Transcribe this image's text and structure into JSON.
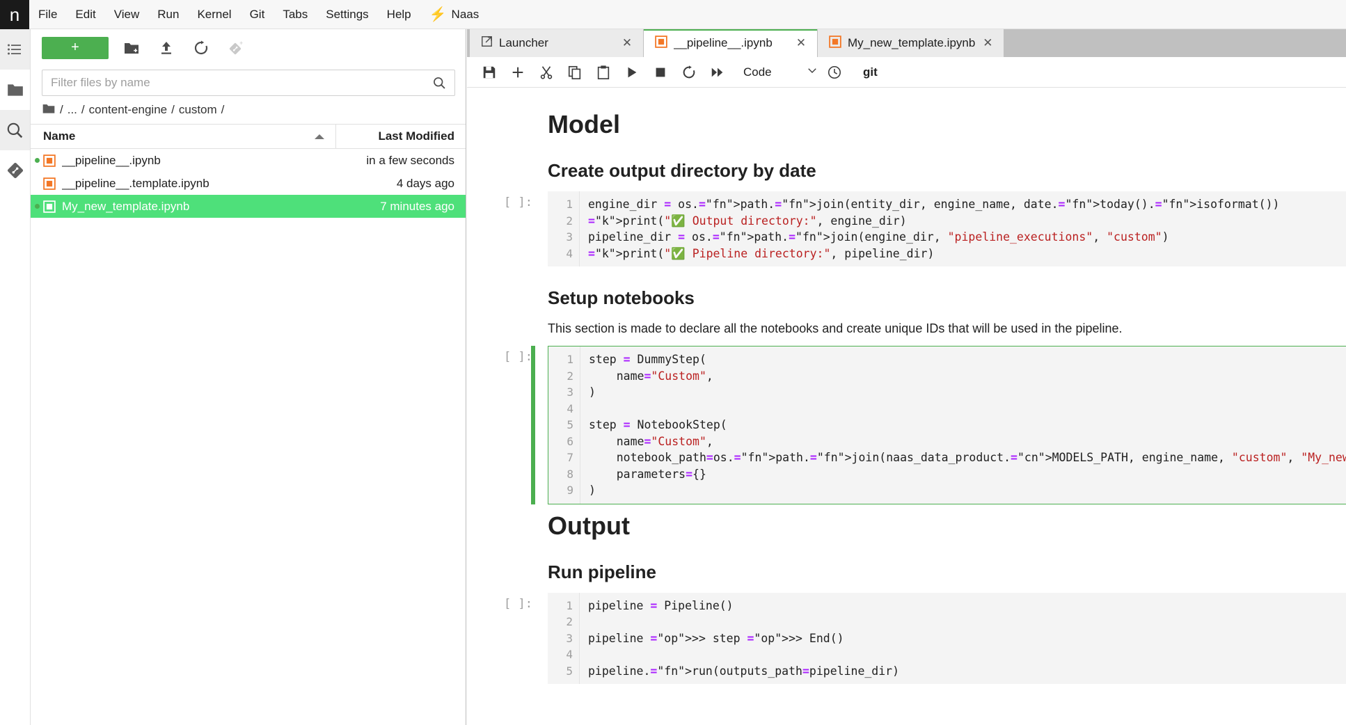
{
  "menubar": {
    "brand": "n",
    "items": [
      "File",
      "Edit",
      "View",
      "Run",
      "Kernel",
      "Git",
      "Tabs",
      "Settings",
      "Help"
    ],
    "naas_label": "Naas"
  },
  "activitybar": {
    "items": [
      {
        "name": "running-terminals-and-kernels",
        "icon": "list-icon"
      },
      {
        "name": "file-browser",
        "icon": "folder-icon"
      },
      {
        "name": "search",
        "icon": "search-icon"
      },
      {
        "name": "git",
        "icon": "git-icon"
      }
    ]
  },
  "filebrowser": {
    "new_launcher_label": "+",
    "toolbar_icons": [
      "new-folder-icon",
      "upload-icon",
      "refresh-icon",
      "new-git-icon"
    ],
    "filter": {
      "placeholder": "Filter files by name",
      "value": ""
    },
    "breadcrumb": [
      "/",
      "...",
      "/",
      "content-engine",
      "/",
      "custom",
      "/"
    ],
    "columns": {
      "name": "Name",
      "modified": "Last Modified"
    },
    "files": [
      {
        "name": "__pipeline__.ipynb",
        "modified": "in a few seconds",
        "running": true,
        "selected": false
      },
      {
        "name": "__pipeline__.template.ipynb",
        "modified": "4 days ago",
        "running": false,
        "selected": false
      },
      {
        "name": "My_new_template.ipynb",
        "modified": "7 minutes ago",
        "running": true,
        "selected": true
      }
    ]
  },
  "tabs": [
    {
      "label": "Launcher",
      "icon": "launcher-icon",
      "active": false,
      "close": "✕"
    },
    {
      "label": "__pipeline__.ipynb",
      "icon": "notebook-icon",
      "active": true,
      "close": "✕"
    },
    {
      "label": "My_new_template.ipynb",
      "icon": "notebook-icon",
      "active": false,
      "close": "✕"
    }
  ],
  "notebook_toolbar": {
    "icons": [
      "save-icon",
      "add-cell-icon",
      "cut-icon",
      "copy-icon",
      "paste-icon",
      "run-icon",
      "stop-icon",
      "restart-icon",
      "restart-run-all-icon"
    ],
    "cell_type": "Code",
    "chevron": "∨",
    "history_icon": "clock-icon",
    "git_label": "git"
  },
  "notebook": {
    "cells": [
      {
        "type": "markdown",
        "style": "h1",
        "text": "Model"
      },
      {
        "type": "markdown",
        "style": "h2",
        "text": "Create output directory by date"
      },
      {
        "type": "code",
        "prompt": "[ ]:",
        "focused": false,
        "lines": [
          "1",
          "2",
          "3",
          "4"
        ],
        "source_plain": [
          "engine_dir = os.path.join(entity_dir, engine_name, date.today().isoformat())",
          "print(\"✅ Output directory:\", engine_dir)",
          "pipeline_dir = os.path.join(engine_dir, \"pipeline_executions\", \"custom\")",
          "print(\"✅ Pipeline directory:\", pipeline_dir)"
        ]
      },
      {
        "type": "markdown",
        "style": "h2",
        "text": "Setup notebooks"
      },
      {
        "type": "markdown",
        "style": "para",
        "text": "This section is made to declare all the notebooks and create unique IDs that will be used in the pipeline."
      },
      {
        "type": "code",
        "prompt": "[ ]:",
        "focused": true,
        "lines": [
          "1",
          "2",
          "3",
          "4",
          "5",
          "6",
          "7",
          "8",
          "9"
        ],
        "source_plain": [
          "step = DummyStep(",
          "    name=\"Custom\",",
          ")",
          "",
          "step = NotebookStep(",
          "    name=\"Custom\",",
          "    notebook_path=os.path.join(naas_data_product.MODELS_PATH, engine_name, \"custom\", \"My_new_template.ipynb\"),",
          "    parameters={}",
          ")"
        ]
      },
      {
        "type": "markdown",
        "style": "h1",
        "text": "Output"
      },
      {
        "type": "markdown",
        "style": "h2",
        "text": "Run pipeline"
      },
      {
        "type": "code",
        "prompt": "[ ]:",
        "focused": false,
        "lines": [
          "1",
          "2",
          "3",
          "4",
          "5"
        ],
        "source_plain": [
          "pipeline = Pipeline()",
          "",
          "pipeline >> step >> End()",
          "",
          "pipeline.run(outputs_path=pipeline_dir)"
        ]
      }
    ]
  },
  "colors": {
    "accent_green": "#4caf50",
    "selection_green": "#4ee07a",
    "notebook_orange": "#f37726",
    "naas_orange": "#ff6b00",
    "tabbar_grey": "#c0c0c0",
    "code_bg": "#f4f4f4"
  }
}
